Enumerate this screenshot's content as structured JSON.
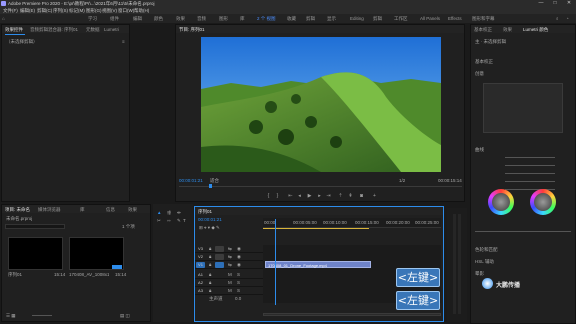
{
  "titlebar": {
    "title": "Adobe Premiere Pro 2020 - E:\\pr\\教程\\Pr\\...\\2021年6月\\11\\5\\未命名.prproj",
    "min": "—",
    "max": "□",
    "close": "✕"
  },
  "menu": [
    "文件(F)",
    "编辑(E)",
    "剪辑(C)",
    "序列(S)",
    "标记(M)",
    "图形(G)",
    "视图(V)",
    "窗口(W)",
    "帮助(H)"
  ],
  "workspaces": [
    "学习",
    "组件",
    "编辑",
    "颜色",
    "效果",
    "音频",
    "图形",
    "库",
    "2 个 视图",
    "收藏",
    "剪辑",
    "显示",
    "Editing",
    "剪辑",
    "工作区",
    "All Panels",
    "Effects",
    "图形和字幕"
  ],
  "workspace_active_index": 8,
  "source_panel": {
    "tabs": [
      "效果控件",
      "音频剪辑混合器: 序列01",
      "元数据",
      "Lumetri"
    ],
    "active_tab": 0,
    "placeholder": "（未选择剪辑）"
  },
  "program_panel": {
    "tab": "节目: 序列01",
    "tc_left": "00:00:01:21",
    "fit": "适合",
    "ratio": "1/2",
    "tc_right": "00:00:15:14"
  },
  "project_panel": {
    "tabs": [
      "项目: 未命名",
      "媒体浏览器",
      "库",
      "信息",
      "效果"
    ],
    "active_tab": 0,
    "project_name": "未命名.prproj",
    "item_count": "1 个项",
    "clips": [
      {
        "name": "序列01",
        "duration": "15:14"
      },
      {
        "name": "170408_AV_1008x1560x1.mp4",
        "duration": "15:14"
      }
    ]
  },
  "timeline": {
    "tab": "序列01",
    "timecode": "00:00:01:21",
    "ruler": [
      "00:00",
      "00:00:05:00",
      "00:00:10:00",
      "00:00:15:00",
      "00:00:20:00",
      "00:00:25:00"
    ],
    "video_tracks": [
      "V3",
      "V2",
      "V1"
    ],
    "audio_tracks": [
      "A1",
      "A2",
      "A3"
    ],
    "master": "主声道",
    "master_value": "0.0",
    "clip_label": "170408_01_Drone_Footage.mp4",
    "playhead_fraction": 0.067
  },
  "keys": [
    "<左键>",
    "<左键>"
  ],
  "watermark": "大鹏传播",
  "lumetri": {
    "tabs": [
      "基本校正",
      "效果",
      "Lumetri 颜色"
    ],
    "active_tab": 2,
    "clip": "主 · 未选择剪辑",
    "sections": [
      "基本校正",
      "创意",
      "曲线",
      "色轮和匹配",
      "HSL 辅助",
      "晕影"
    ],
    "wheels": [
      "阴影",
      "中间调",
      "高光"
    ]
  },
  "colors": {
    "accent": "#2d8ceb",
    "key_bg": "#3976b8",
    "clip_video": "#6e83c9"
  }
}
